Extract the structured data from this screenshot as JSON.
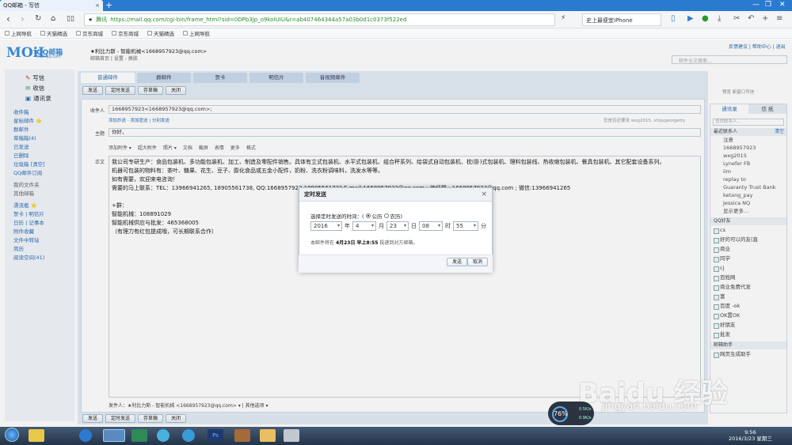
{
  "browser": {
    "tab_title": "QQ邮箱 - 写信",
    "tab_close": "×",
    "new_tab": "+",
    "url_site": "腾讯",
    "url": "https://mail.qq.com/cgi-bin/frame_html?sid=0DPb3Jp_o9koIUIU&r=ab407464344a57a03b0d1c0373f522ed",
    "search_text": "史上最便宜iPhone",
    "bookmarks": [
      "上网导航",
      "天猫精选",
      "京东商城",
      "京东商城",
      "天猫精选",
      "上网导航"
    ]
  },
  "qqmail": {
    "logo": "MOiL",
    "logo_cn": "QQ邮箱",
    "logo_url": "mail.qq.com",
    "user": "★利比力斯 - 智能机械<1668957923@qq.com>",
    "user_links": "邮箱首页 | 设置 - 换肤",
    "top_links": "反馈建议 | 帮助中心 | 退出",
    "search_placeholder": "邮件全文搜索..."
  },
  "sidebar": {
    "compose": "写信",
    "inbox": "收信",
    "contacts": "通讯录",
    "folders": [
      "收件箱",
      "星标邮件 ⭐",
      "群邮件",
      "草稿箱(4)",
      "已发送",
      "已删除",
      "垃圾箱 [清空]",
      "QQ邮件订阅"
    ],
    "more": [
      "我的文件夹",
      "其他邮箱"
    ],
    "apps": [
      "漂流瓶 ⭐",
      "贺卡 | 明信片",
      "日历 | 记事本",
      "附件收藏",
      "文件中转站",
      "简历",
      "阅读空间(41)"
    ]
  },
  "compose": {
    "tabs": [
      "普通邮件",
      "群邮件",
      "贺卡",
      "明信片",
      "音视频邮件"
    ],
    "toolbar": [
      "发送",
      "定时发送",
      "存草稿",
      "关闭"
    ],
    "right_hint": "预览    新窗口写信",
    "to_label": "收件人",
    "to_value": "1668957923<1668957923@qq.com>;",
    "to_links": "添加抄送 - 添加密送 | 分别发送",
    "to_right": "您是否还要发 wxg2015, shijugeorgetty",
    "subject_label": "主题",
    "subject_value": "你好，",
    "format_bar": [
      "添加附件 ▾",
      "超大附件",
      "照片 ▾",
      "文档",
      "截屏",
      "表情",
      "更多",
      "格式"
    ],
    "body_label": "正文",
    "body_lines": [
      "我公司专研生产：食品包装机、多功能包装机、加工、制造及零配件销售。具体有立式包装机、水平式包装机、组合秤系列、给袋式自动包装机、枕(卧)式包装机、理料包装线、热收缩包装机、餐具包装机、其它配套设备系列。",
      "机器可包装的物料有：茶叶、糖果、花生、豆子、膨化食品或五金小配件，奶粉、洗衣粉调味料，洗发水等等。",
      "如有需要，欢迎来电咨询！",
      "需要的马上联系：TEL：13966941265, 18905561738, QQ:1668957923 1890556173? E-mail:1668957923@qq.com ; 徐经理 ; 1668957923@qq.com ; 微信:13966941265",
      "",
      "+群：",
      "智能机械：108891029",
      "智能机械供应与批发：465368005",
      "（有理力有红包提成哦，可长期联系合作）"
    ],
    "footer": "发件人：★利比力斯 - 智能机械 <1668957923@qq.com> ▾   |   其他选项 ▾"
  },
  "right_panel": {
    "tabs": [
      "通讯录",
      "信 纸"
    ],
    "search": "查找联系人...",
    "recent_header": "最近联系人",
    "recent_clear": "清空",
    "recent": [
      "注意",
      "1668957923",
      "wxg2015",
      "Lynefer FB",
      "iim",
      "replay to",
      "Guaranty Trust Bank",
      "ketang_pay",
      "Jessica NQ",
      "显示更多..."
    ],
    "groups_header": "QQ好友",
    "groups": [
      "cs",
      "好的可以的友(直",
      "商业",
      "同学",
      "cj",
      "百姓网",
      "商业免费代发",
      "富",
      "百度 -ok",
      "OK置OK",
      "好朋友",
      "批发"
    ],
    "assist_header": "邮箱助手",
    "assist": [
      "网页生成助手"
    ]
  },
  "dialog": {
    "title": "定时发送",
    "close": "×",
    "prompt": "选择定时发送的时间：(",
    "opt1": "公历",
    "opt2": "农历)",
    "year": "2016",
    "year_unit": "年",
    "month": "4",
    "month_unit": "月",
    "day": "23",
    "day_unit": "日",
    "hour": "08",
    "hour_unit": "时",
    "minute": "55",
    "minute_unit": "分",
    "note_pre": "本邮件将在",
    "note_time": "4月23日 早上8:55",
    "note_post": "投递到对方邮箱。",
    "send": "发送",
    "cancel": "取消"
  },
  "perf": {
    "value": "76%",
    "up": "0.5K/s",
    "down": "0.9K/s"
  },
  "watermark": {
    "brand": "Baidu 经验",
    "url": "jingyan.baidu.com"
  },
  "taskbar": {
    "time": "9:56",
    "date": "2016/3/23 星期三"
  }
}
